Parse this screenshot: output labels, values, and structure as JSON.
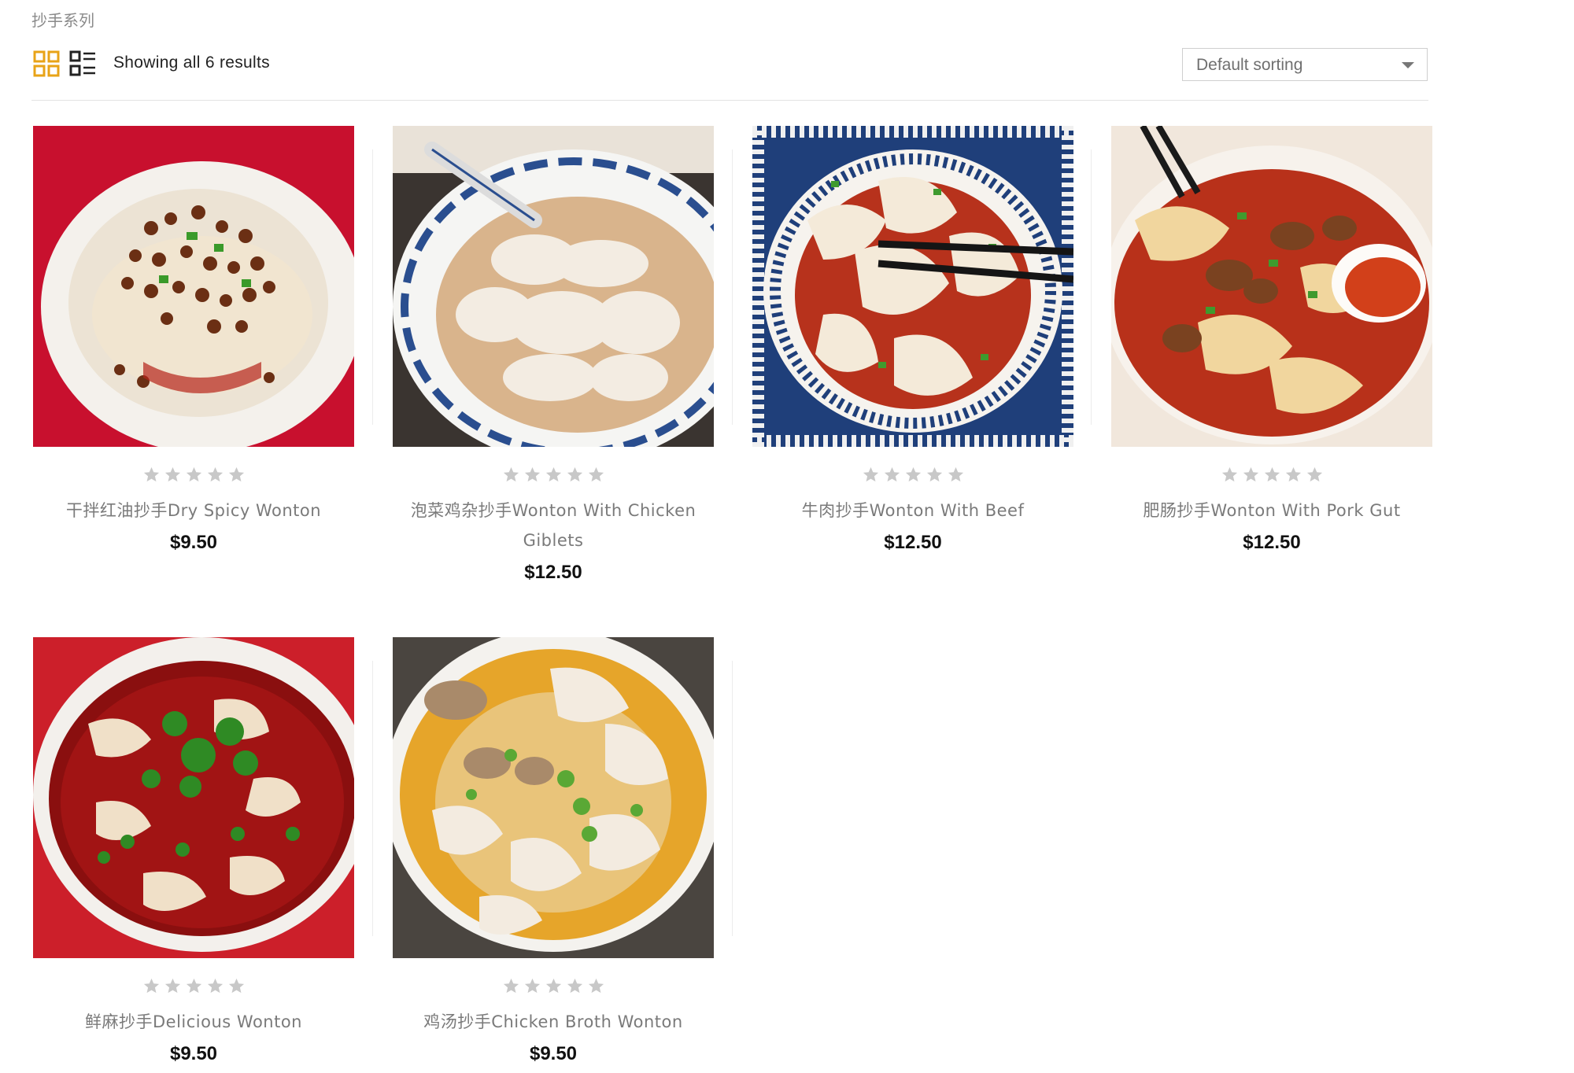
{
  "breadcrumb": {
    "label": "抄手系列"
  },
  "toolbar": {
    "grid_icon": "grid-view-icon",
    "list_icon": "list-view-icon",
    "result_count": "Showing all 6 results",
    "sort": {
      "selected": "Default sorting"
    }
  },
  "colors": {
    "accent": "#e8a317",
    "star": "#c8c8c8",
    "price": "#111111"
  },
  "products": [
    {
      "title": "干拌红油抄手Dry Spicy Wonton",
      "price": "$9.50",
      "rating": 0
    },
    {
      "title": "泡菜鸡杂抄手Wonton With Chicken Giblets",
      "price": "$12.50",
      "rating": 0
    },
    {
      "title": "牛肉抄手Wonton With Beef",
      "price": "$12.50",
      "rating": 0
    },
    {
      "title": "肥肠抄手Wonton With Pork Gut",
      "price": "$12.50",
      "rating": 0
    },
    {
      "title": "鲜麻抄手Delicious Wonton",
      "price": "$9.50",
      "rating": 0
    },
    {
      "title": "鸡汤抄手Chicken Broth Wonton",
      "price": "$9.50",
      "rating": 0
    }
  ]
}
